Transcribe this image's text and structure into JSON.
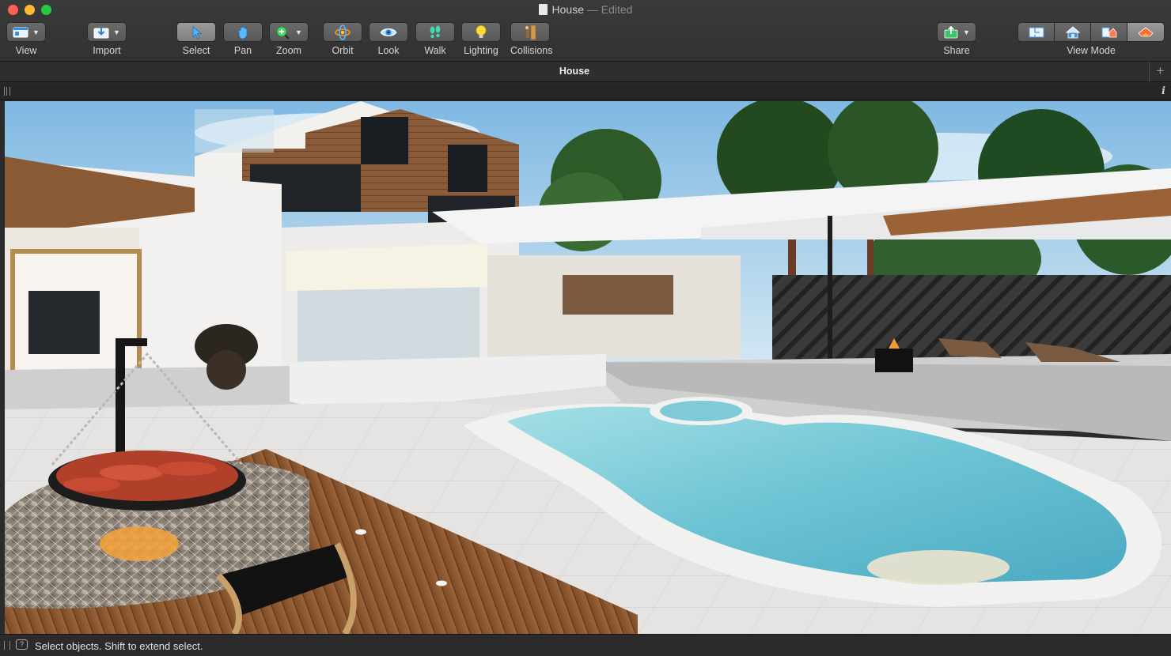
{
  "window": {
    "title": "House",
    "edited_suffix": "— Edited"
  },
  "toolbar": {
    "view": "View",
    "import": "Import",
    "select": "Select",
    "pan": "Pan",
    "zoom": "Zoom",
    "orbit": "Orbit",
    "look": "Look",
    "walk": "Walk",
    "lighting": "Lighting",
    "collisions": "Collisions",
    "share": "Share",
    "view_mode": "View Mode",
    "active_tool": "Select",
    "active_view_mode": "3D"
  },
  "tabbar": {
    "title": "House",
    "add": "+"
  },
  "infobar": {
    "info": "i"
  },
  "status": {
    "help": "?",
    "message": "Select objects. Shift to extend select."
  },
  "colors": {
    "accent_select": "#4fb3ff",
    "pool_water": "#7cc9d6",
    "deck_wood": "#8b5a33",
    "sky": "#8fc4e8"
  }
}
